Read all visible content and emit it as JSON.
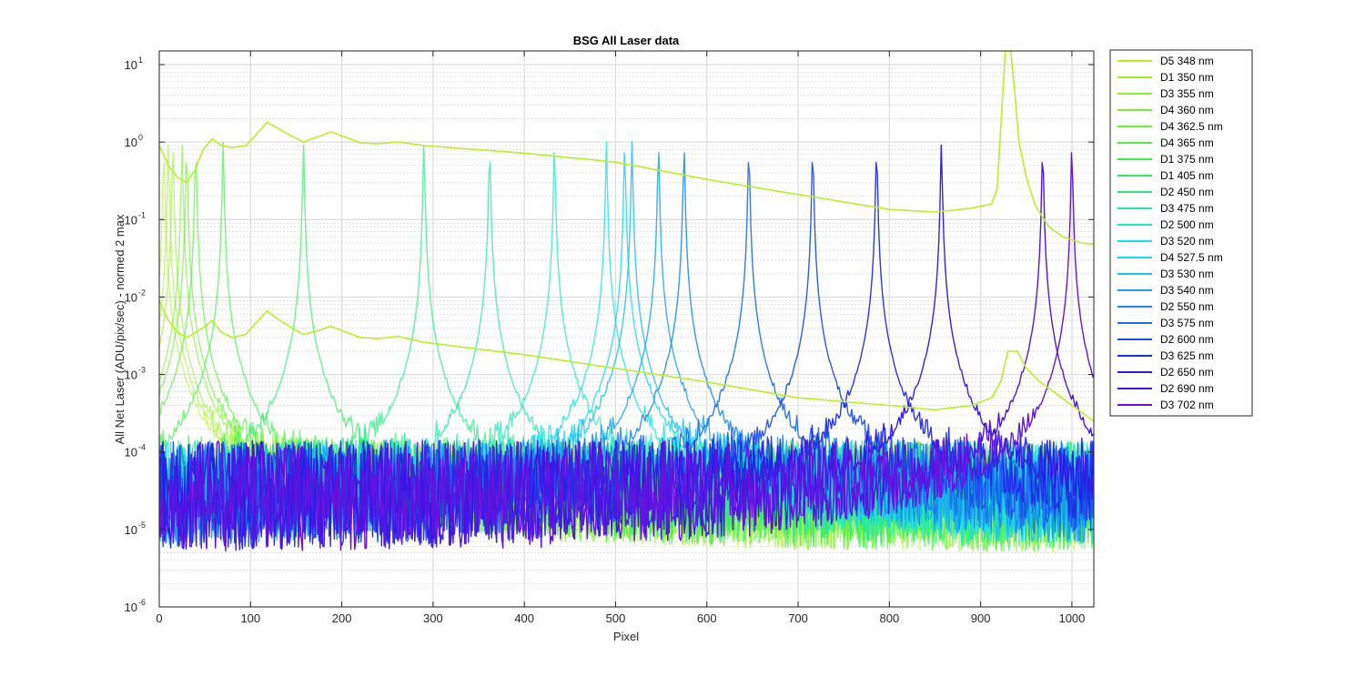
{
  "chart_data": {
    "type": "line",
    "title": "BSG  All Laser data",
    "xlabel": "Pixel",
    "ylabel": "All Net Laser (ADU/pix/sec) - normed 2 max",
    "xlim": [
      0,
      1024
    ],
    "ylim": [
      1e-06,
      15
    ],
    "yscale": "log",
    "grid": true,
    "minor_grid": true,
    "legend_position": "outside-right",
    "x_ticks": [
      0,
      100,
      200,
      300,
      400,
      500,
      600,
      700,
      800,
      900,
      1000
    ],
    "x_tick_labels": [
      "0",
      "100",
      "200",
      "300",
      "400",
      "500",
      "600",
      "700",
      "800",
      "900",
      "1000"
    ],
    "y_ticks": [
      {
        "exp": -6,
        "label": "10",
        "sup": "-6"
      },
      {
        "exp": -5,
        "label": "10",
        "sup": "-5"
      },
      {
        "exp": -4,
        "label": "10",
        "sup": "-4"
      },
      {
        "exp": -3,
        "label": "10",
        "sup": "-3"
      },
      {
        "exp": -2,
        "label": "10",
        "sup": "-2"
      },
      {
        "exp": -1,
        "label": "10",
        "sup": "-1"
      },
      {
        "exp": 0,
        "label": "10",
        "sup": "0"
      },
      {
        "exp": 1,
        "label": "10",
        "sup": "1"
      }
    ],
    "series": [
      {
        "name": "D5 348 nm",
        "peak_pixel": 5,
        "color": "#b0f020"
      },
      {
        "name": "D1 350 nm",
        "peak_pixel": 10,
        "color": "#a2f024"
      },
      {
        "name": "D3 355 nm",
        "peak_pixel": 15,
        "color": "#8ef028"
      },
      {
        "name": "D4 360 nm",
        "peak_pixel": 25,
        "color": "#7cf02c"
      },
      {
        "name": "D4 362.5 nm",
        "peak_pixel": 30,
        "color": "#66f030"
      },
      {
        "name": "D4 365 nm",
        "peak_pixel": 40,
        "color": "#50ee38"
      },
      {
        "name": "D1 375 nm",
        "peak_pixel": 70,
        "color": "#3eee48"
      },
      {
        "name": "D1 405 nm",
        "peak_pixel": 158,
        "color": "#30ec64"
      },
      {
        "name": "D2 450 nm",
        "peak_pixel": 290,
        "color": "#28ea82"
      },
      {
        "name": "D3 475 nm",
        "peak_pixel": 362,
        "color": "#22e8a2"
      },
      {
        "name": "D2 500 nm",
        "peak_pixel": 433,
        "color": "#1ee8c2"
      },
      {
        "name": "D3 520 nm",
        "peak_pixel": 490,
        "color": "#1ae4de"
      },
      {
        "name": "D4 527.5 nm",
        "peak_pixel": 510,
        "color": "#18d8f0"
      },
      {
        "name": "D3 530 nm",
        "peak_pixel": 518,
        "color": "#18c0f2"
      },
      {
        "name": "D3 540 nm",
        "peak_pixel": 547,
        "color": "#1aa4f0"
      },
      {
        "name": "D2 550 nm",
        "peak_pixel": 575,
        "color": "#1a88ee"
      },
      {
        "name": "D3 575 nm",
        "peak_pixel": 646,
        "color": "#1a6aec"
      },
      {
        "name": "D2 600 nm",
        "peak_pixel": 716,
        "color": "#1a4aea"
      },
      {
        "name": "D3 625 nm",
        "peak_pixel": 786,
        "color": "#1e2ae6"
      },
      {
        "name": "D2 650 nm",
        "peak_pixel": 857,
        "color": "#3018e4"
      },
      {
        "name": "D2 690 nm",
        "peak_pixel": 968,
        "color": "#4a12e2"
      },
      {
        "name": "D3 702 nm",
        "peak_pixel": 1000,
        "color": "#6414de"
      }
    ],
    "broad_curves": [
      {
        "color": "#b8f028",
        "points": [
          [
            0,
            0.9
          ],
          [
            10,
            0.5
          ],
          [
            20,
            0.35
          ],
          [
            30,
            0.3
          ],
          [
            40,
            0.45
          ],
          [
            48,
            0.8
          ],
          [
            58,
            1.1
          ],
          [
            68,
            0.9
          ],
          [
            80,
            0.85
          ],
          [
            95,
            0.9
          ],
          [
            105,
            1.2
          ],
          [
            118,
            1.8
          ],
          [
            130,
            1.5
          ],
          [
            145,
            1.2
          ],
          [
            158,
            1.0
          ],
          [
            172,
            1.15
          ],
          [
            188,
            1.35
          ],
          [
            205,
            1.15
          ],
          [
            220,
            0.98
          ],
          [
            240,
            0.95
          ],
          [
            262,
            1.0
          ],
          [
            290,
            0.9
          ],
          [
            400,
            0.72
          ],
          [
            500,
            0.55
          ],
          [
            600,
            0.33
          ],
          [
            700,
            0.21
          ],
          [
            800,
            0.135
          ],
          [
            850,
            0.125
          ],
          [
            890,
            0.14
          ],
          [
            912,
            0.16
          ],
          [
            918,
            0.25
          ],
          [
            922,
            1.5
          ],
          [
            927,
            15
          ],
          [
            933,
            15
          ],
          [
            937,
            5
          ],
          [
            942,
            1.0
          ],
          [
            950,
            0.35
          ],
          [
            960,
            0.15
          ],
          [
            975,
            0.08
          ],
          [
            990,
            0.06
          ],
          [
            1010,
            0.05
          ],
          [
            1024,
            0.048
          ]
        ]
      },
      {
        "color": "#b8f028",
        "points": [
          [
            0,
            0.009
          ],
          [
            10,
            0.005
          ],
          [
            20,
            0.0035
          ],
          [
            30,
            0.003
          ],
          [
            40,
            0.0035
          ],
          [
            48,
            0.004
          ],
          [
            58,
            0.005
          ],
          [
            68,
            0.0035
          ],
          [
            80,
            0.003
          ],
          [
            95,
            0.0033
          ],
          [
            105,
            0.0045
          ],
          [
            118,
            0.0066
          ],
          [
            130,
            0.0052
          ],
          [
            145,
            0.004
          ],
          [
            158,
            0.0033
          ],
          [
            172,
            0.0036
          ],
          [
            188,
            0.0042
          ],
          [
            205,
            0.0035
          ],
          [
            220,
            0.003
          ],
          [
            240,
            0.0029
          ],
          [
            262,
            0.0031
          ],
          [
            290,
            0.0026
          ],
          [
            400,
            0.0018
          ],
          [
            500,
            0.0012
          ],
          [
            600,
            0.0008
          ],
          [
            700,
            0.0005
          ],
          [
            800,
            0.0004
          ],
          [
            850,
            0.00035
          ],
          [
            890,
            0.0004
          ],
          [
            912,
            0.0005
          ],
          [
            922,
            0.0008
          ],
          [
            930,
            0.002
          ],
          [
            940,
            0.002
          ],
          [
            950,
            0.0012
          ],
          [
            965,
            0.0008
          ],
          [
            980,
            0.0006
          ],
          [
            1000,
            0.0004
          ],
          [
            1024,
            0.00025
          ]
        ]
      }
    ]
  }
}
